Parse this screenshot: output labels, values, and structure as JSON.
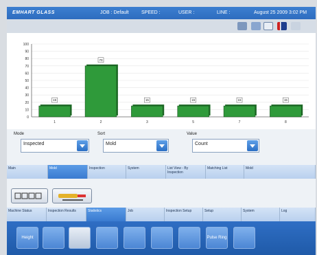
{
  "titlebar": {
    "logo": "EMHART GLASS",
    "job": "JOB : Default",
    "speed": "SPEED :",
    "user": "USER :",
    "line": "LINE :",
    "datetime": "August 25  2009 3:02 PM"
  },
  "toolbar": {
    "icons": [
      "keyboard-icon",
      "window-icon",
      "book-icon",
      "uk-flag-icon",
      "person-icon"
    ]
  },
  "chart_data": {
    "type": "bar",
    "categories": [
      "1",
      "2",
      "3",
      "5",
      "7",
      "8"
    ],
    "values": [
      15,
      70,
      15,
      15,
      15,
      15
    ],
    "data_labels": [
      "15",
      "70",
      "15",
      "15",
      "15",
      "15"
    ],
    "yticks": [
      "100",
      "90",
      "80",
      "70",
      "60",
      "50",
      "40",
      "30",
      "20",
      "10",
      "0"
    ],
    "ylim": [
      0,
      100
    ],
    "grid": true,
    "bar_color": "#2f9a3a"
  },
  "controls": {
    "mode": {
      "label": "Mode",
      "value": "Inspected"
    },
    "sort": {
      "label": "Sort",
      "value": "Mold"
    },
    "value": {
      "label": "Value",
      "value": "Count"
    }
  },
  "tabs1": [
    "Main",
    "Mold",
    "Inspection",
    "System",
    "List View - By Inspection",
    "Matching List",
    "Mold"
  ],
  "tabs2": [
    "Machine Status",
    "Inspection Results",
    "Statistics",
    "Job",
    "Inspection Setup",
    "Setup",
    "System",
    "Log"
  ],
  "bottom": {
    "height": "Height",
    "pulse": "Pulse Ring"
  }
}
